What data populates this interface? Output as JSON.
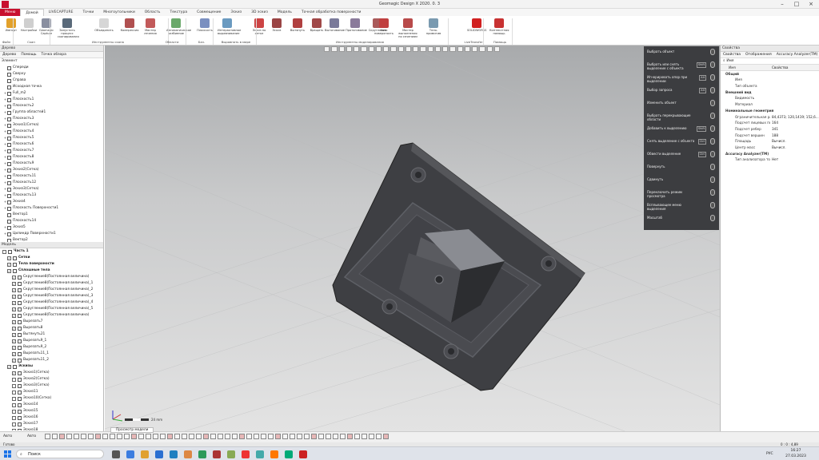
{
  "window": {
    "title": "Geomagic Design X 2020. 0. 3"
  },
  "menu": {
    "file": "Меню",
    "tabs": [
      "Домой",
      "LIVECAPTURE",
      "Точки",
      "Многоугольники",
      "Область",
      "Текстура",
      "Совмещение",
      "Эскиз",
      "3D эскиз",
      "Модель",
      "Точная обработка поверхности"
    ],
    "active_index": 0
  },
  "ribbon": {
    "buttons": [
      {
        "label": "Импорт",
        "color": "#e2a12b"
      },
      {
        "label": "Настройки",
        "color": "#cfcfcf"
      },
      {
        "label": "Geomagic Capture",
        "color": "#8a8fa0"
      },
      {
        "label": "Запустить процесс сканирования",
        "color": "#5a6a7a"
      },
      {
        "label": "Объединить",
        "color": "#d6d6d6"
      },
      {
        "label": "Компрессия",
        "color": "#b05050"
      },
      {
        "label": "Мастер лечения",
        "color": "#c25a5a"
      },
      {
        "label": "Автоматическое разбиение",
        "color": "#6aa86a"
      },
      {
        "label": "Плоскость",
        "color": "#7a8fc0"
      },
      {
        "label": "Интерактивное выравнивание",
        "color": "#6a9ac0"
      },
      {
        "label": "Эскиз по сетке",
        "color": "#cc4444"
      },
      {
        "label": "Эскиз",
        "color": "#9a4444"
      },
      {
        "label": "Вытянуть",
        "color": "#b04040"
      },
      {
        "label": "Вращать",
        "color": "#a04848"
      },
      {
        "label": "Вытягивание",
        "color": "#7a7a9a"
      },
      {
        "label": "Протягивание",
        "color": "#8a7a9a"
      },
      {
        "label": "Скругление",
        "color": "#aa5a5a"
      },
      {
        "label": "Авто поверхность",
        "color": "#c04040"
      },
      {
        "label": "Мастер выполнения по сечениям",
        "color": "#b84a4a"
      },
      {
        "label": "Тело-примитив",
        "color": "#7a9ab0"
      },
      {
        "label": "SOLIDWORKS",
        "color": "#d12020"
      },
      {
        "label": "Контекстная помощь",
        "color": "#c83232"
      }
    ],
    "groups": [
      {
        "label": "Файл"
      },
      {
        "label": "Скан"
      },
      {
        "label": "Инструменты скана"
      },
      {
        "label": "Области"
      },
      {
        "label": "Баз. геометрия"
      },
      {
        "label": "Выровнять в мире"
      },
      {
        "label": "Инструменты моделирования"
      },
      {
        "label": "LiveTransfer"
      },
      {
        "label": "Помощь"
      }
    ]
  },
  "left_panel": {
    "header": "Дерево",
    "tabs": [
      "Дерево",
      "Помощь",
      "Точка обзора"
    ],
    "tree_title": "Элемент",
    "tree_items": [
      {
        "label": "Спереди",
        "exp": ""
      },
      {
        "label": "Сверху",
        "exp": ""
      },
      {
        "label": "Справа",
        "exp": ""
      },
      {
        "label": "Исходная точка",
        "exp": ""
      },
      {
        "label": "Full_m2",
        "exp": "+"
      },
      {
        "label": "Плоскость1",
        "exp": "+"
      },
      {
        "label": "Плоскость2",
        "exp": "+"
      },
      {
        "label": "Группа областей1",
        "exp": "+"
      },
      {
        "label": "Плоскость3",
        "exp": "+"
      },
      {
        "label": "Эскиз1(Сетка)",
        "exp": "+"
      },
      {
        "label": "Плоскость4",
        "exp": "+"
      },
      {
        "label": "Плоскость5",
        "exp": "+"
      },
      {
        "label": "Плоскость6",
        "exp": "+"
      },
      {
        "label": "Плоскость7",
        "exp": "+"
      },
      {
        "label": "Плоскость8",
        "exp": "+"
      },
      {
        "label": "Плоскость9",
        "exp": "+"
      },
      {
        "label": "Эскиз2(Сетка)",
        "exp": "+"
      },
      {
        "label": "Плоскость11",
        "exp": "+"
      },
      {
        "label": "Плоскость12",
        "exp": "+"
      },
      {
        "label": "Эскиз3(Сетка)",
        "exp": "+"
      },
      {
        "label": "Плоскость13",
        "exp": "+"
      },
      {
        "label": "Эскиз4",
        "exp": "+"
      },
      {
        "label": "Плоскость Поверхности1",
        "exp": "+"
      },
      {
        "label": "Вектор1",
        "exp": ""
      },
      {
        "label": "Плоскость14",
        "exp": ""
      },
      {
        "label": "Эскиз5",
        "exp": "+"
      },
      {
        "label": "Цилиндр Поверхности1",
        "exp": "+"
      },
      {
        "label": "Вектор2",
        "exp": ""
      }
    ],
    "model_header": "Модель",
    "model_items": [
      {
        "label": "Часть 1",
        "bold": true,
        "indent": 0,
        "chk": false
      },
      {
        "label": "Сетки",
        "bold": true,
        "indent": 1,
        "chk": true
      },
      {
        "label": "Тела поверхности",
        "bold": true,
        "indent": 1,
        "chk": true
      },
      {
        "label": "Сплошные тела",
        "bold": true,
        "indent": 1,
        "chk": true
      },
      {
        "label": "Скругление8(Постоянная величина)",
        "bold": false,
        "indent": 2,
        "chk": true
      },
      {
        "label": "Скругление8(Постоянная величина)_1",
        "bold": false,
        "indent": 2,
        "chk": true
      },
      {
        "label": "Скругление8(Постоянная величина)_2",
        "bold": false,
        "indent": 2,
        "chk": true
      },
      {
        "label": "Скругление8(Постоянная величина)_3",
        "bold": false,
        "indent": 2,
        "chk": true
      },
      {
        "label": "Скругление8(Постоянная величина)_4",
        "bold": false,
        "indent": 2,
        "chk": true
      },
      {
        "label": "Скругление8(Постоянная величина)_5",
        "bold": false,
        "indent": 2,
        "chk": true
      },
      {
        "label": "Скругление8(Постоянная величина)",
        "bold": false,
        "indent": 2,
        "chk": true
      },
      {
        "label": "Вырезать7",
        "bold": false,
        "indent": 2,
        "chk": true
      },
      {
        "label": "Вырезать8",
        "bold": false,
        "indent": 2,
        "chk": true
      },
      {
        "label": "Вытянуть21",
        "bold": false,
        "indent": 2,
        "chk": true
      },
      {
        "label": "Вырезать9_1",
        "bold": false,
        "indent": 2,
        "chk": true
      },
      {
        "label": "Вырезать9_2",
        "bold": false,
        "indent": 2,
        "chk": true
      },
      {
        "label": "Вырезать11_1",
        "bold": false,
        "indent": 2,
        "chk": true
      },
      {
        "label": "Вырезать11_2",
        "bold": false,
        "indent": 2,
        "chk": true
      },
      {
        "label": "Эскизы",
        "bold": true,
        "indent": 1,
        "chk": true
      },
      {
        "label": "Эскиз1(Сетка)",
        "bold": false,
        "indent": 2,
        "chk": true
      },
      {
        "label": "Эскиз2(Сетка)",
        "bold": false,
        "indent": 2,
        "chk": false
      },
      {
        "label": "Эскиз3(Сетка)",
        "bold": false,
        "indent": 2,
        "chk": false
      },
      {
        "label": "Эскиз11",
        "bold": false,
        "indent": 2,
        "chk": false
      },
      {
        "label": "Эскиз10(Сетка)",
        "bold": false,
        "indent": 2,
        "chk": false
      },
      {
        "label": "Эскиз14",
        "bold": false,
        "indent": 2,
        "chk": false
      },
      {
        "label": "Эскиз15",
        "bold": false,
        "indent": 2,
        "chk": false
      },
      {
        "label": "Эскиз16",
        "bold": false,
        "indent": 2,
        "chk": false
      },
      {
        "label": "Эскиз17",
        "bold": false,
        "indent": 2,
        "chk": false
      },
      {
        "label": "Эскиз18",
        "bold": false,
        "indent": 2,
        "chk": false
      }
    ]
  },
  "quick_menu": {
    "items": [
      {
        "label": "Выбрать объект",
        "key": ""
      },
      {
        "label": "Выбрать или снять выделение с объекта",
        "key": "Shift"
      },
      {
        "label": "Игнорировать опор при выделении",
        "key": "Alt"
      },
      {
        "label": "Выбор запроса",
        "key": "Alt"
      },
      {
        "label": "Изменить объект",
        "key": ""
      },
      {
        "label": "Выбрать перекрывающие области",
        "key": ""
      },
      {
        "label": "Добавить к выделению",
        "key": "Shift"
      },
      {
        "label": "Снять выделение с объекта",
        "key": "Ctrl"
      },
      {
        "label": "Обвести выделение",
        "key": "Ctrl"
      },
      {
        "label": "Повернуть",
        "key": ""
      },
      {
        "label": "Сдвинуть",
        "key": ""
      },
      {
        "label": "Переключить режим просмотра",
        "key": ""
      },
      {
        "label": "Всплывающее меню выделения",
        "key": ""
      },
      {
        "label": "Масштаб",
        "key": ""
      }
    ]
  },
  "right_panel": {
    "header": "Свойства",
    "tabs": [
      "Свойства",
      "Отображения",
      "Accuracy Analyzer(TM)"
    ],
    "search_label": "Имя",
    "col_name": "Имя",
    "col_value": "Свойства",
    "rows": [
      {
        "name": "Общий",
        "value": "",
        "cat": true
      },
      {
        "name": "Имя",
        "value": "",
        "cat": false
      },
      {
        "name": "Тип объекта",
        "value": "",
        "cat": false
      },
      {
        "name": "Внешний вид",
        "value": "",
        "cat": true
      },
      {
        "name": "Видимость",
        "value": "",
        "cat": false
      },
      {
        "name": "Материал",
        "value": "",
        "cat": false
      },
      {
        "name": "Номинальные геометрия",
        "value": "",
        "cat": true
      },
      {
        "name": "Ограничительная рамка",
        "value": "84,4373; 120,1419; 152,6...",
        "cat": false
      },
      {
        "name": "Подсчет лицевых по...",
        "value": "164",
        "cat": false
      },
      {
        "name": "Подсчет ребер",
        "value": "341",
        "cat": false
      },
      {
        "name": "Подсчет вершин",
        "value": "188",
        "cat": false
      },
      {
        "name": "Площадь",
        "value": "Вычисл.",
        "cat": false
      },
      {
        "name": "Центр масс",
        "value": "Вычисл.",
        "cat": false
      },
      {
        "name": "Accuracy Analyzer(TM)",
        "value": "",
        "cat": true
      },
      {
        "name": "Тип анализатора то...",
        "value": "Нет",
        "cat": false
      }
    ]
  },
  "viewport": {
    "tab_label": "Просмотр модели",
    "scale_label": "24 mm"
  },
  "bottom": {
    "mode": "Авто",
    "mode2": "Авто"
  },
  "status": {
    "left": "Готово",
    "right": "0 : 0 : 4,89"
  },
  "taskbar": {
    "search_placeholder": "Поиск",
    "time": "16:27",
    "date": "27.03.2023",
    "lang": "РУС"
  }
}
